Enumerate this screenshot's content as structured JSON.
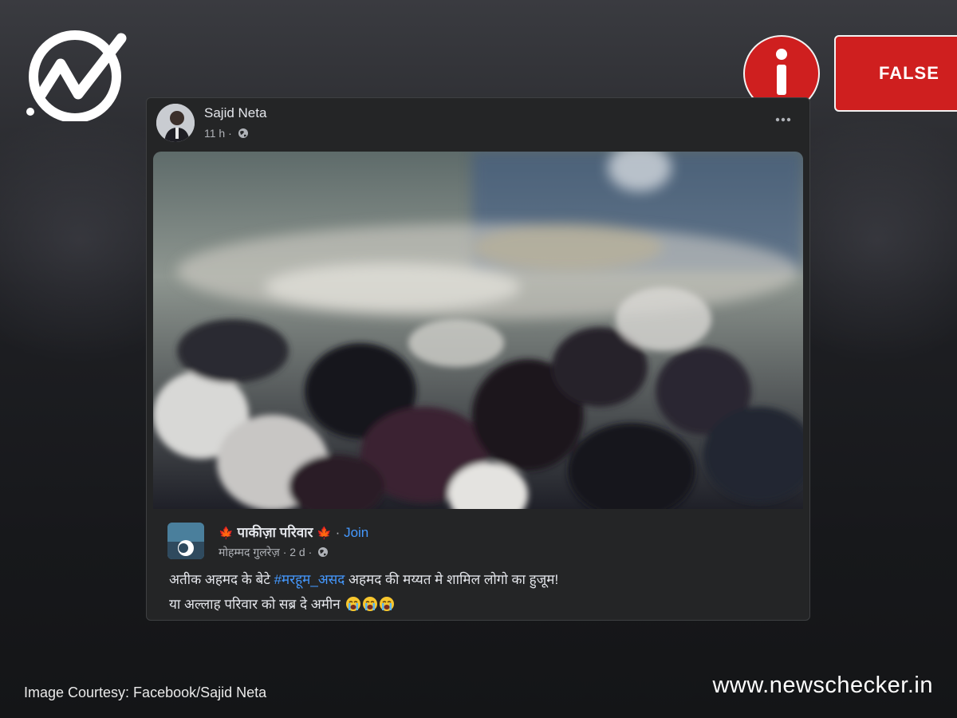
{
  "brand": {
    "logo_icon": "newschecker-check-logo-icon",
    "website": "www.newschecker.in"
  },
  "verdict": {
    "icon": "info-icon",
    "label": "FALSE",
    "color": "#cf1f1f"
  },
  "post": {
    "author": "Sajid Neta",
    "time": "11 h ·",
    "privacy_icon": "globe-icon",
    "more_icon": "more-options-icon",
    "media_icon": "video-thumbnail-crowd",
    "shared": {
      "group_name": "पाकीज़ा परिवार",
      "group_emoji": "🍁",
      "join_label": "Join",
      "poster": "मोहम्मद गुलरेज़",
      "time": "· 2 d ·",
      "caption_line1_prefix": "अतीक अहमद के बेटे ",
      "hashtag": "#मरहूम_असद",
      "caption_line1_suffix": " अहमद की मय्यत मे शामिल लोगो का हुजूम!",
      "caption_line2": "या अल्लाह परिवार को सब्र दे अमीन",
      "crying_emoji_icon": "loudly-crying-face-icon"
    }
  },
  "courtesy": "Image Courtesy: Facebook/Sajid Neta",
  "colors": {
    "facebook_card": "#242526",
    "link": "#4599ff",
    "background": "#1e1f23"
  }
}
